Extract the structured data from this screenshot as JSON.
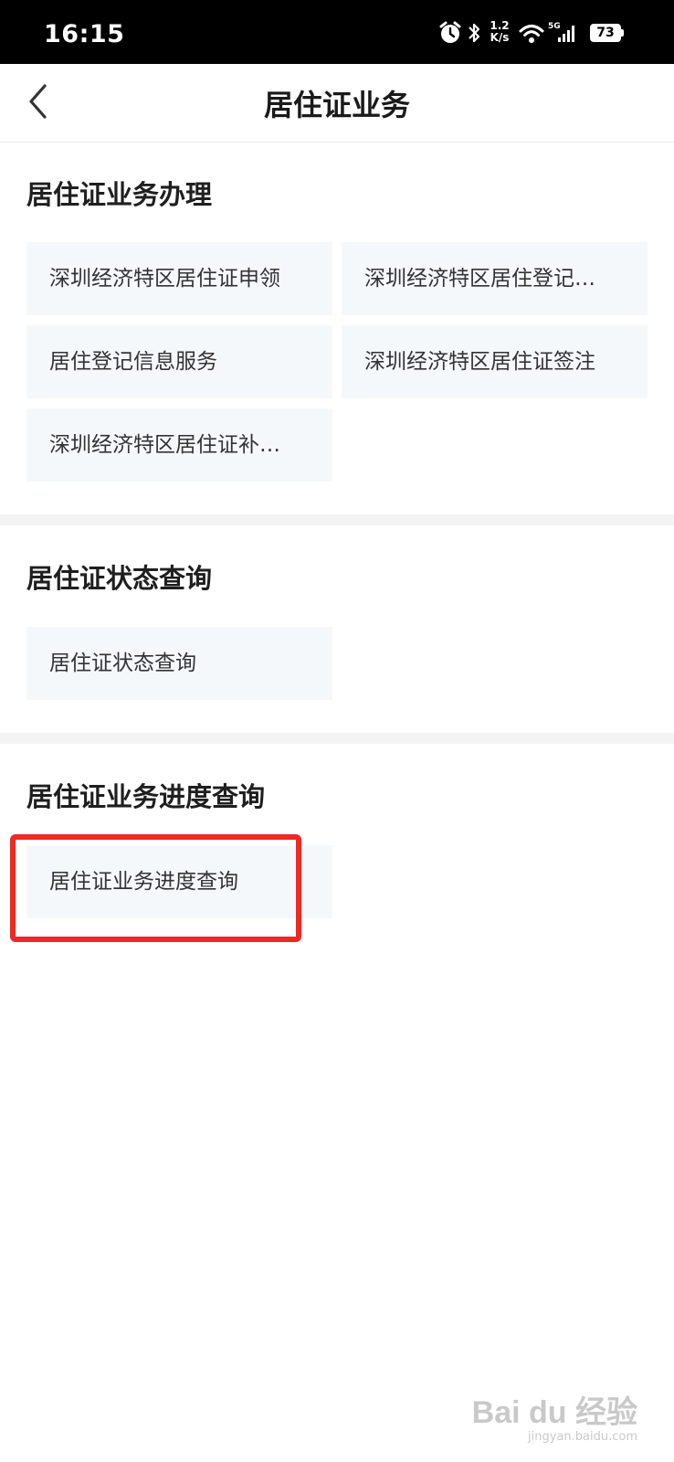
{
  "status_bar": {
    "time": "16:15",
    "net_speed_value": "1.2",
    "net_speed_unit": "K/s",
    "network_type": "5G",
    "battery_level": "73",
    "icons": [
      "alarm-icon",
      "bluetooth-icon",
      "wifi-icon",
      "signal-icon",
      "battery-icon"
    ]
  },
  "nav": {
    "title": "居住证业务",
    "back_icon": "chevron-left-icon"
  },
  "sections": [
    {
      "title": "居住证业务办理",
      "items": [
        "深圳经济特区居住证申领",
        "深圳经济特区居住登记…",
        "居住登记信息服务",
        "深圳经济特区居住证签注",
        "深圳经济特区居住证补…"
      ]
    },
    {
      "title": "居住证状态查询",
      "items": [
        "居住证状态查询"
      ]
    },
    {
      "title": "居住证业务进度查询",
      "items": [
        "居住证业务进度查询"
      ]
    }
  ],
  "annotation": {
    "highlight_color": "#ee2a24"
  },
  "watermark": {
    "text": "Bai du 经验",
    "sub": "jingyan.baidu.com"
  }
}
